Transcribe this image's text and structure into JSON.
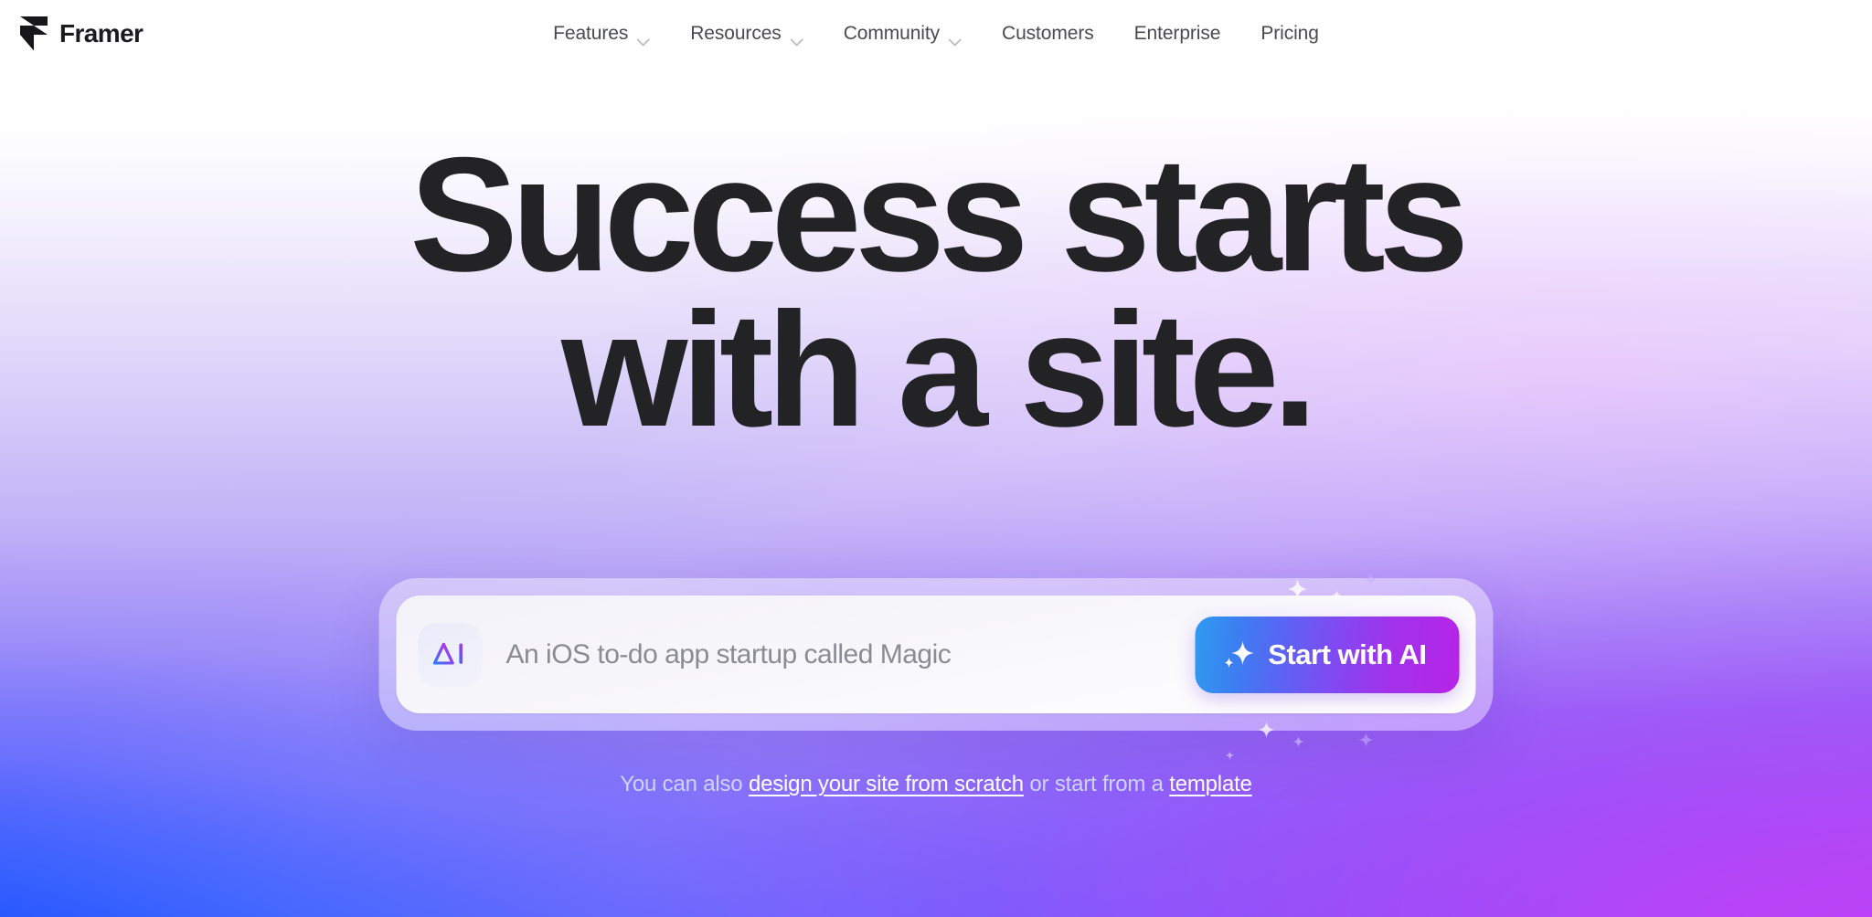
{
  "brand": {
    "name": "Framer",
    "logo_icon": "framer-logo-icon"
  },
  "nav": {
    "items": [
      {
        "label": "Features",
        "has_caret": true,
        "icon": "chevron-down-icon"
      },
      {
        "label": "Resources",
        "has_caret": true,
        "icon": "chevron-down-icon"
      },
      {
        "label": "Community",
        "has_caret": true,
        "icon": "chevron-down-icon"
      },
      {
        "label": "Customers",
        "has_caret": false,
        "icon": ""
      },
      {
        "label": "Enterprise",
        "has_caret": false,
        "icon": ""
      },
      {
        "label": "Pricing",
        "has_caret": false,
        "icon": ""
      }
    ]
  },
  "hero": {
    "title_line_1": "Success starts",
    "title_line_2": "with a site.",
    "title_color": "#232326"
  },
  "prompt": {
    "badge_icon": "ai-badge-icon",
    "input_value": "",
    "input_placeholder": "An iOS to-do app startup called Magic",
    "cta_icon": "sparkle-icon",
    "cta_label": "Start with AI",
    "cta_gradient_from": "#2f9bf0",
    "cta_gradient_mid": "#8348f2",
    "cta_gradient_to": "#b624e7"
  },
  "subtext": {
    "before": "You can also ",
    "link_scratch": "design your site from scratch",
    "middle": " or start from a ",
    "link_template": "template"
  },
  "theme": {
    "background_top": "#ffffff",
    "background_bottom_left": "#0a46ff",
    "background_bottom_right": "#c440f6",
    "placeholder_color": "#8b8b93",
    "nav_text_color": "#4a4a52"
  }
}
